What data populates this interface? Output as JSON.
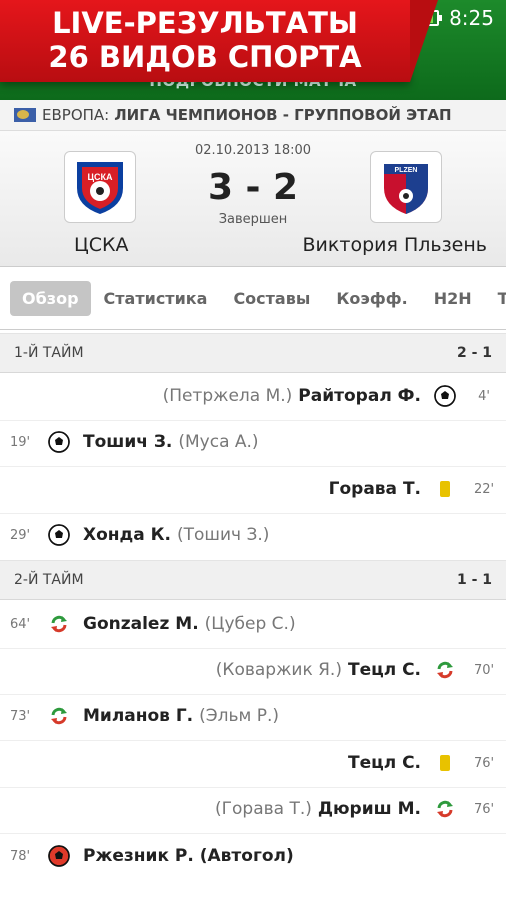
{
  "promo": {
    "line1": "LIVE-РЕЗУЛЬТАТЫ",
    "line2": "26 ВИДОВ СПОРТА"
  },
  "status_bar": {
    "time": "8:25"
  },
  "header": {
    "subtitle": "ПОДРОБНОСТИ МАТЧА"
  },
  "league": {
    "region": "ЕВРОПА:",
    "name": "ЛИГА ЧЕМПИОНОВ - ГРУППОВОЙ ЭТАП"
  },
  "match": {
    "date": "02.10.2013 18:00",
    "score": "3 - 2",
    "status": "Завершен",
    "home_team": "ЦСКА",
    "home_logo_text": "ЦСКА",
    "away_team": "Виктория Пльзень",
    "away_logo_text": "PLZEN"
  },
  "tabs": [
    "Обзор",
    "Статистика",
    "Составы",
    "Коэфф.",
    "H2H",
    "Т"
  ],
  "periods": [
    {
      "label": "1-Й ТАЙМ",
      "score": "2 - 1"
    },
    {
      "label": "2-Й ТАЙМ",
      "score": "1 - 1"
    }
  ],
  "events": [
    {
      "side": "away",
      "minute": "4'",
      "player": "Райторал Ф.",
      "assist": "(Петржела М.)",
      "icon": "goal-ball-icon"
    },
    {
      "side": "home",
      "minute": "19'",
      "player": "Тошич З.",
      "assist": "(Муса А.)",
      "icon": "goal-ball-icon"
    },
    {
      "side": "away",
      "minute": "22'",
      "player": "Горава Т.",
      "assist": "",
      "icon": "yellow-card-icon"
    },
    {
      "side": "home",
      "minute": "29'",
      "player": "Хонда К.",
      "assist": "(Тошич З.)",
      "icon": "goal-ball-icon"
    },
    {
      "side": "home",
      "minute": "64'",
      "player": "Gonzalez M.",
      "assist": "(Цубер С.)",
      "icon": "substitution-icon"
    },
    {
      "side": "away",
      "minute": "70'",
      "player": "Тецл С.",
      "assist": "(Коваржик Я.)",
      "icon": "substitution-icon"
    },
    {
      "side": "home",
      "minute": "73'",
      "player": "Миланов Г.",
      "assist": "(Эльм Р.)",
      "icon": "substitution-icon"
    },
    {
      "side": "away",
      "minute": "76'",
      "player": "Тецл С.",
      "assist": "",
      "icon": "yellow-card-icon"
    },
    {
      "side": "away",
      "minute": "76'",
      "player": "Дюриш М.",
      "assist": "(Горава Т.)",
      "icon": "substitution-icon"
    },
    {
      "side": "home",
      "minute": "78'",
      "player": "Ржезник Р. (Автогол)",
      "assist": "",
      "icon": "own-goal-icon"
    }
  ],
  "colors": {
    "header_green": "#1d8a2b",
    "promo_red": "#e5161b",
    "yellow_card": "#e8c200",
    "sub_green": "#2e9a3d",
    "sub_red": "#d63a2a"
  }
}
